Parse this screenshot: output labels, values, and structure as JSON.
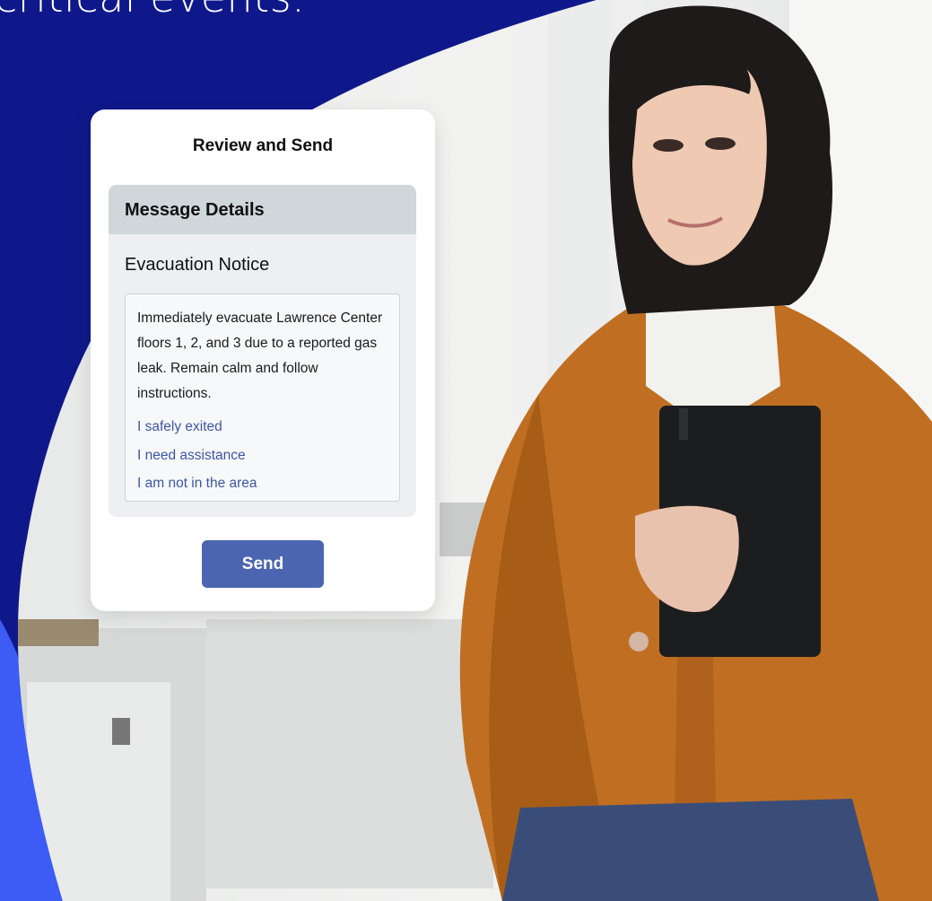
{
  "page": {
    "headline": "critical events.",
    "colors": {
      "background": "#0f188a",
      "accent_curve": "#3c5cf5",
      "photo_wall": "#eceded"
    }
  },
  "card": {
    "title": "Review and Send",
    "details_header": "Message Details",
    "notice_title": "Evacuation Notice",
    "message": "Immediately evacuate Lawrence Center floors 1, 2, and 3 due to a reported gas leak. Remain calm and follow instructions.",
    "responses": [
      "I safely exited",
      "I need assistance",
      "I am not in the area"
    ],
    "send_label": "Send",
    "colors": {
      "button": "#4b65b0",
      "response_link": "#3d579e",
      "header": "#cfd7da"
    }
  },
  "photo": {
    "description_icon": "person-photo"
  }
}
